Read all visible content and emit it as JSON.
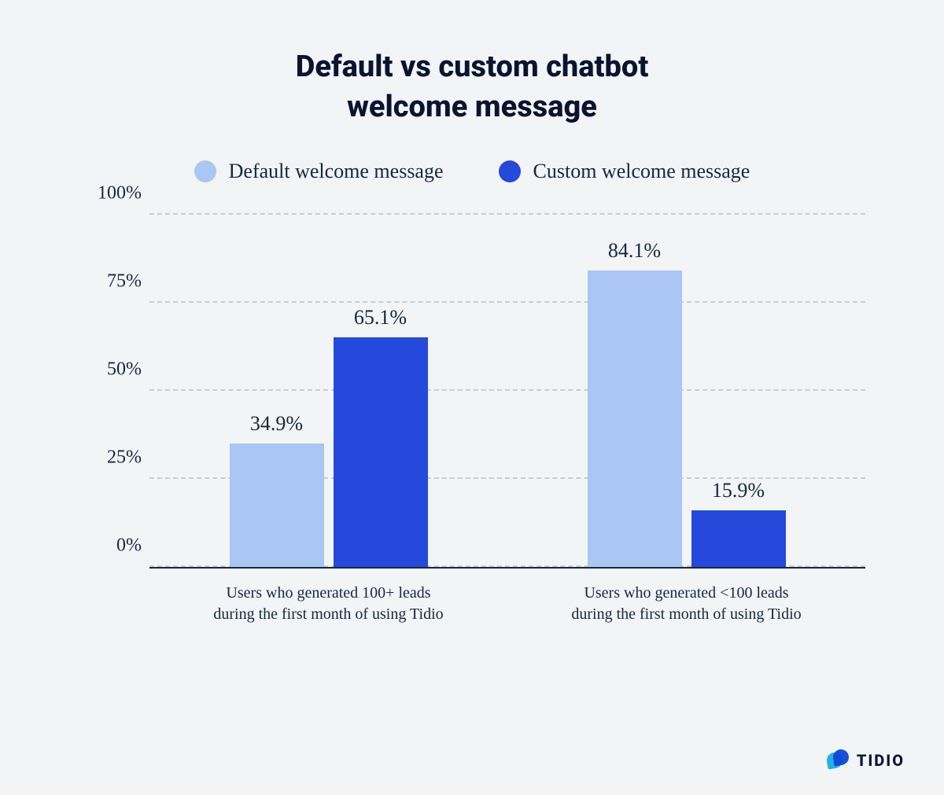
{
  "title_line1": "Default vs custom chatbot",
  "title_line2": "welcome message",
  "legend": {
    "default": "Default welcome message",
    "custom": "Custom welcome message"
  },
  "colors": {
    "default": "#a9c7f2",
    "custom": "#2449db"
  },
  "yticks": [
    "0%",
    "25%",
    "50%",
    "75%",
    "100%"
  ],
  "brand": "TIDIO",
  "chart_data": {
    "type": "bar",
    "title": "Default vs custom chatbot welcome message",
    "ylabel": "",
    "xlabel": "",
    "ylim": [
      0,
      100
    ],
    "y_unit": "%",
    "categories": [
      "Users who generated 100+ leads during the first month of using Tidio",
      "Users who generated <100 leads during the first month of using Tidio"
    ],
    "categories_2line": [
      {
        "l1": "Users who generated 100+ leads",
        "l2": "during the first month of using Tidio"
      },
      {
        "l1": "Users who generated <100 leads",
        "l2": "during the first month of using Tidio"
      }
    ],
    "series": [
      {
        "name": "Default welcome message",
        "values": [
          34.9,
          84.1
        ]
      },
      {
        "name": "Custom welcome message",
        "values": [
          65.1,
          15.9
        ]
      }
    ],
    "value_labels": [
      [
        "34.9%",
        "84.1%"
      ],
      [
        "65.1%",
        "15.9%"
      ]
    ]
  }
}
